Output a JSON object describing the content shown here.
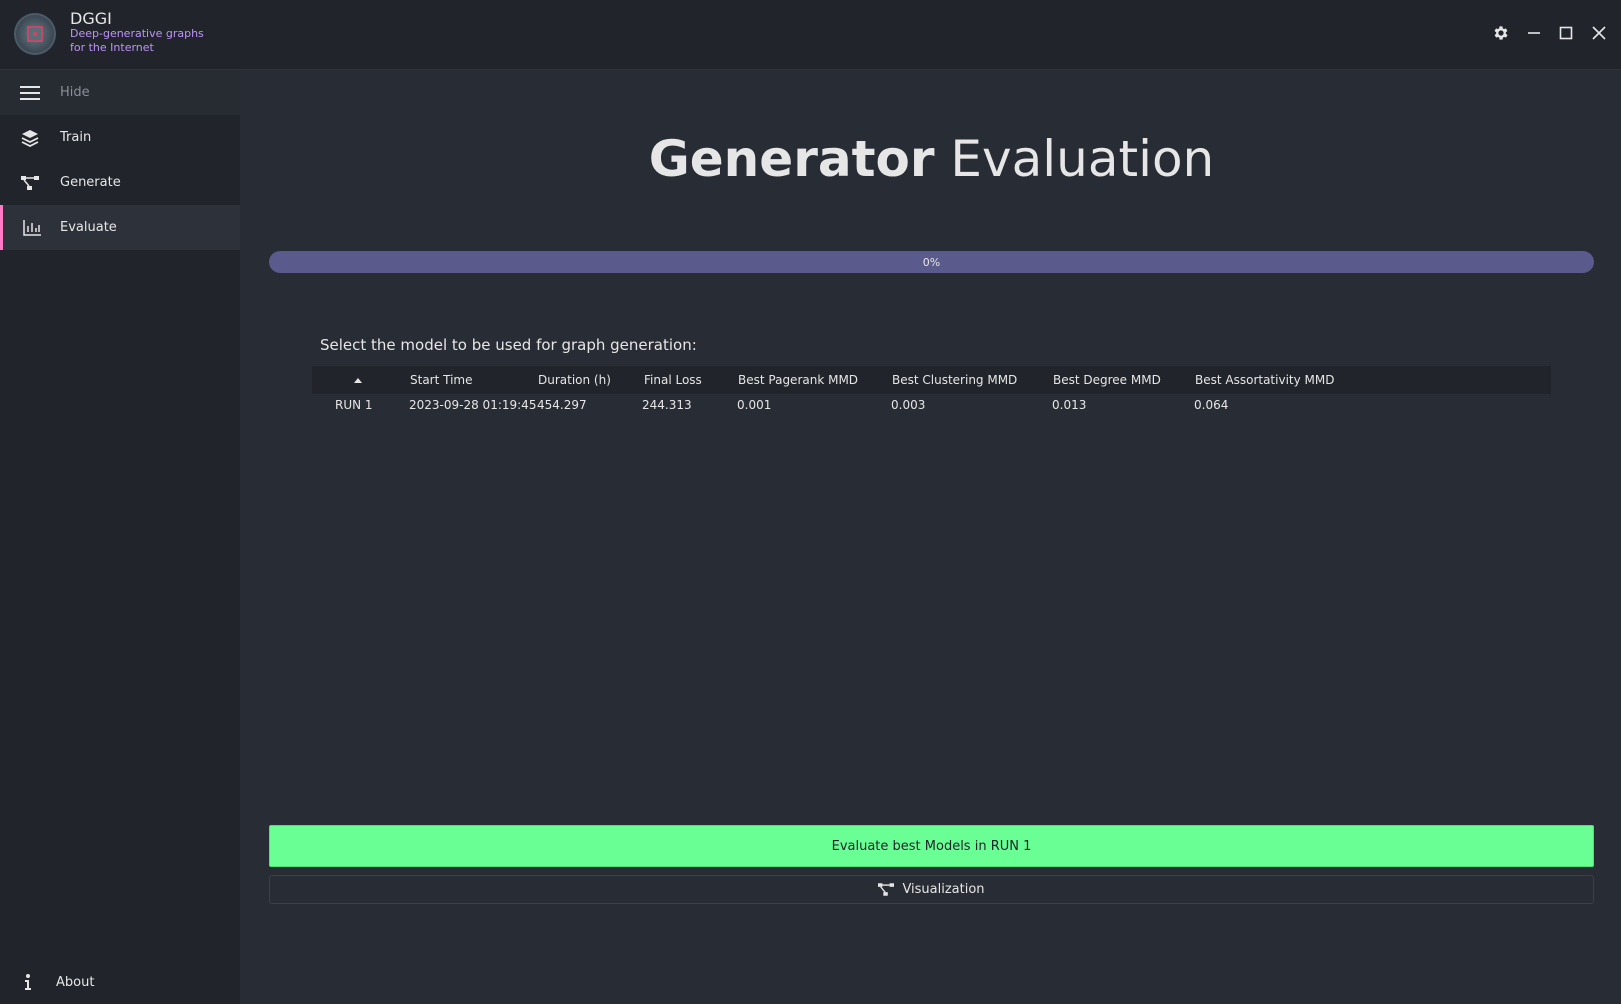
{
  "app": {
    "title": "DGGI",
    "subtitle": "Deep-generative graphs for the Internet"
  },
  "window_controls": [
    "gear-icon",
    "minimize-icon",
    "maximize-icon",
    "close-icon"
  ],
  "sidebar": {
    "hide_label": "Hide",
    "items": [
      {
        "label": "Train",
        "icon": "layers-icon"
      },
      {
        "label": "Generate",
        "icon": "graph-icon"
      },
      {
        "label": "Evaluate",
        "icon": "chart-icon",
        "active": true
      }
    ],
    "about_label": "About"
  },
  "main": {
    "title_bold": "Generator",
    "title_rest": "Evaluation",
    "progress_text": "0%",
    "progress_value": 0,
    "prompt": "Select the model to be used for graph generation:",
    "table": {
      "headers": [
        "",
        "Start Time",
        "Duration (h)",
        "Final Loss",
        "Best Pagerank MMD",
        "Best Clustering MMD",
        "Best Degree MMD",
        "Best Assortativity MMD"
      ],
      "rows": [
        [
          "RUN 1",
          "2023-09-28 01:19:45",
          "454.297",
          "244.313",
          "0.001",
          "0.003",
          "0.013",
          "0.064"
        ]
      ]
    },
    "evaluate_button": "Evaluate best Models in RUN 1",
    "visualization_button": "Visualization"
  },
  "colors": {
    "accent": "#ff79c6",
    "primary_button": "#69ff94",
    "subtitle": "#bd93f9",
    "progress": "#5a5a8c"
  }
}
